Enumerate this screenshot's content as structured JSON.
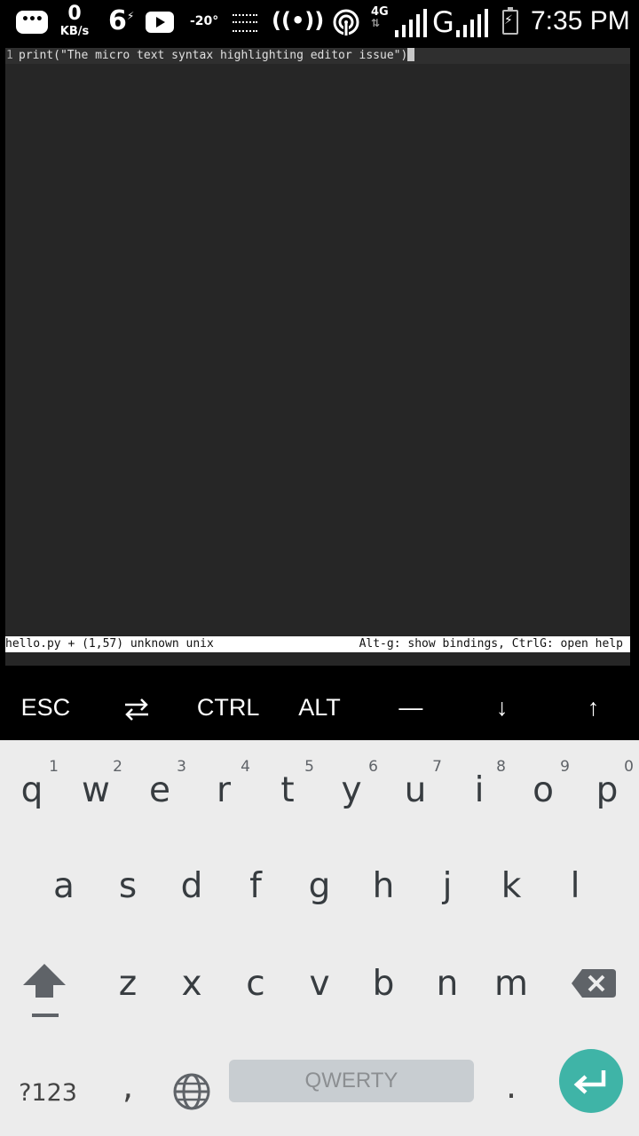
{
  "status_bar": {
    "net_speed_value": "0",
    "net_speed_unit": "KB/s",
    "notif_six": "6",
    "temperature": "-20°",
    "network_type": "4G",
    "carrier_letter": "G",
    "time": "7:35 PM"
  },
  "editor": {
    "line_number": "1",
    "line_text": "print(\"The micro text syntax highlighting editor issue\")",
    "status_left": "hello.py + (1,57) unknown unix",
    "status_right": "Alt-g: show bindings, CtrlG: open help"
  },
  "extra_keys": {
    "esc": "ESC",
    "ctrl": "CTRL",
    "alt": "ALT",
    "dash": "—",
    "down": "↓",
    "up": "↑"
  },
  "keyboard": {
    "row1": [
      {
        "ch": "q",
        "hint": "1"
      },
      {
        "ch": "w",
        "hint": "2"
      },
      {
        "ch": "e",
        "hint": "3"
      },
      {
        "ch": "r",
        "hint": "4"
      },
      {
        "ch": "t",
        "hint": "5"
      },
      {
        "ch": "y",
        "hint": "6"
      },
      {
        "ch": "u",
        "hint": "7"
      },
      {
        "ch": "i",
        "hint": "8"
      },
      {
        "ch": "o",
        "hint": "9"
      },
      {
        "ch": "p",
        "hint": "0"
      }
    ],
    "row2": [
      "a",
      "s",
      "d",
      "f",
      "g",
      "h",
      "j",
      "k",
      "l"
    ],
    "row3": [
      "z",
      "x",
      "c",
      "v",
      "b",
      "n",
      "m"
    ],
    "symbols": "?123",
    "comma": ",",
    "space": "QWERTY",
    "period": ".",
    "enter_color": "#3fb4a7"
  }
}
